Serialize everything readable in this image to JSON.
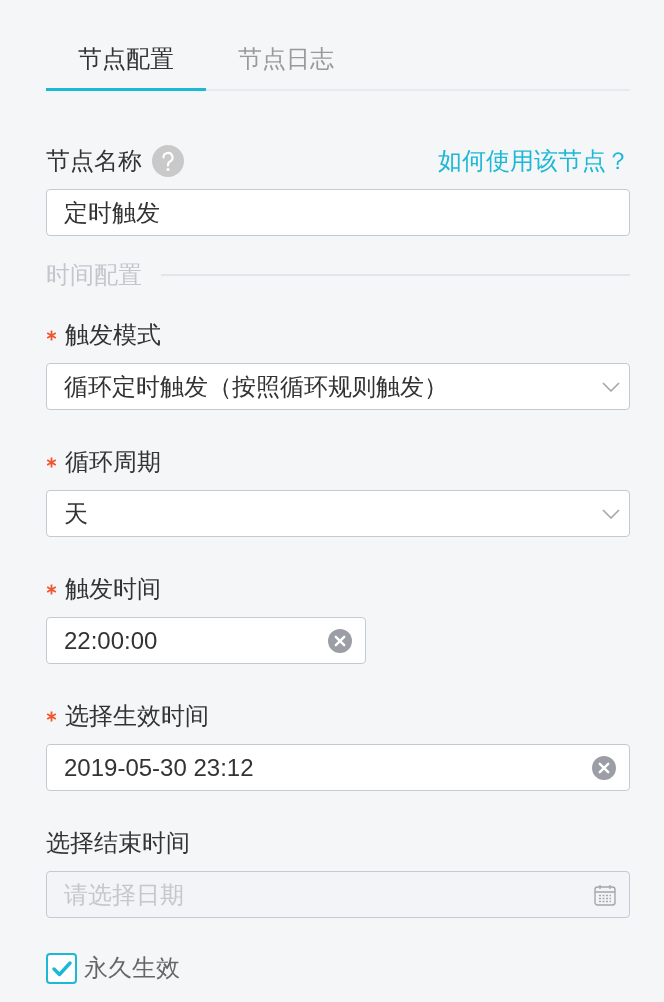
{
  "tabs": [
    {
      "label": "节点配置",
      "selected": true
    },
    {
      "label": "节点日志",
      "selected": false
    }
  ],
  "node_name": {
    "label": "节点名称",
    "help_link": "如何使用该节点？",
    "value": "定时触发"
  },
  "section": {
    "title": "时间配置"
  },
  "fields": [
    {
      "kind": "select",
      "label": "触发模式",
      "required": true,
      "disabled": false,
      "value": "循环定时触发（按照循环规则触发）"
    },
    {
      "kind": "select",
      "label": "循环周期",
      "required": true,
      "disabled": false,
      "value": "天"
    },
    {
      "kind": "time",
      "label": "触发时间",
      "required": true,
      "disabled": false,
      "value": "22:00:00"
    },
    {
      "kind": "datetime",
      "label": "选择生效时间",
      "required": true,
      "disabled": false,
      "value": "2019-05-30 23:12"
    },
    {
      "kind": "date",
      "label": "选择结束时间",
      "required": false,
      "disabled": true,
      "placeholder": "请选择日期"
    }
  ],
  "permanent": {
    "label": "永久生效",
    "checked": true
  }
}
